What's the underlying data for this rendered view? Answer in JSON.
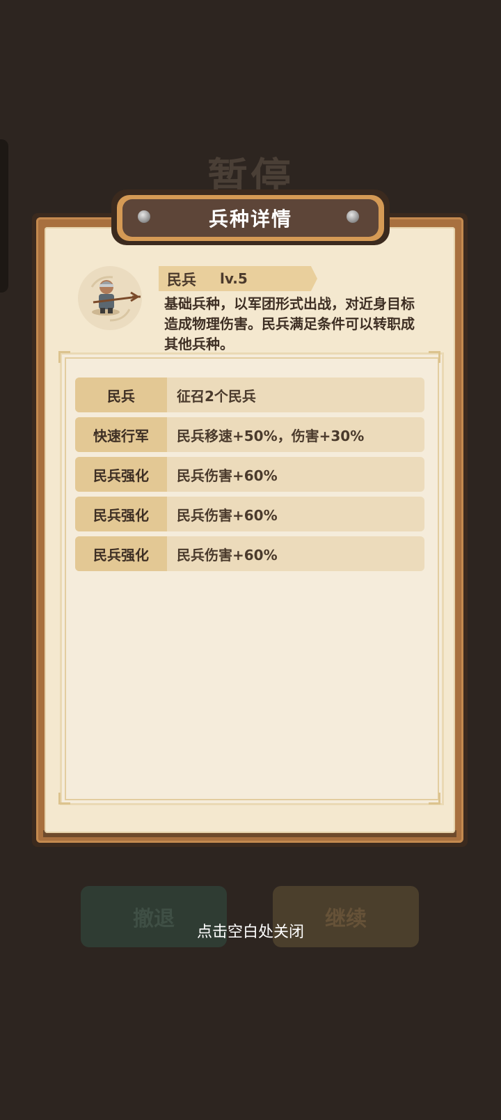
{
  "background": {
    "pause_title": "暂停",
    "retreat_label": "撤退",
    "continue_label": "继续"
  },
  "dialog": {
    "title": "兵种详情",
    "unit": {
      "name": "民兵",
      "level": "lv.5",
      "description": "基础兵种，以军团形式出战，对近身目标造成物理伤害。民兵满足条件可以转职成其他兵种。"
    },
    "upgrades": [
      {
        "name": "民兵",
        "effect": "征召2个民兵"
      },
      {
        "name": "快速行军",
        "effect": "民兵移速+50%，伤害+30%"
      },
      {
        "name": "民兵强化",
        "effect": "民兵伤害+60%"
      },
      {
        "name": "民兵强化",
        "effect": "民兵伤害+60%"
      },
      {
        "name": "民兵强化",
        "effect": "民兵伤害+60%"
      }
    ]
  },
  "close_hint": "点击空白处关闭",
  "colors": {
    "backdrop": "#2d2520",
    "parchment": "#f4e8cf",
    "frame": "#a8703f",
    "title_plate": "#5d4538",
    "tag": "#e3c894"
  }
}
